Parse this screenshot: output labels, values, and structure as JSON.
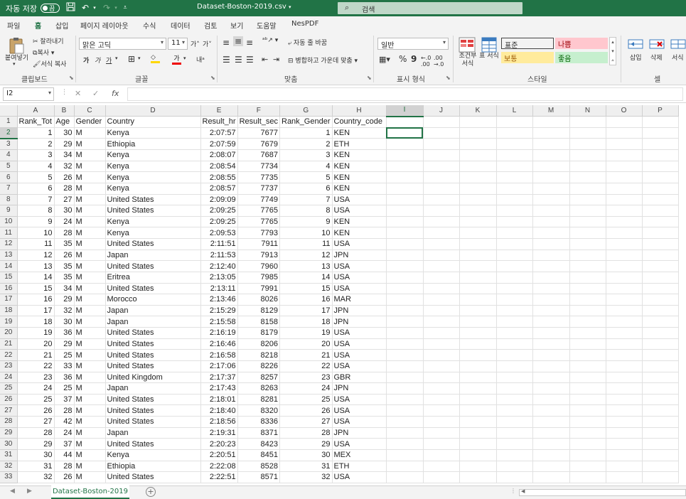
{
  "titlebar": {
    "autosave_label": "자동 저장",
    "autosave_state": "끔",
    "filename": "Dataset-Boston-2019.csv",
    "search_placeholder": "검색"
  },
  "ribbon_tabs": [
    "파일",
    "홈",
    "삽입",
    "페이지 레이아웃",
    "수식",
    "데이터",
    "검토",
    "보기",
    "도움말",
    "NesPDF"
  ],
  "active_tab": "홈",
  "ribbon": {
    "clipboard": {
      "paste": "붙여넣기",
      "cut": "잘라내기",
      "copy": "복사",
      "format_painter": "서식 복사",
      "group": "클립보드"
    },
    "font": {
      "name": "맑은 고딕",
      "size": "11",
      "bold": "가",
      "italic": "가",
      "underline": "가",
      "group": "글꼴"
    },
    "alignment": {
      "wrap": "자동 줄 바꿈",
      "merge": "병합하고 가운데 맞춤",
      "group": "맞춤"
    },
    "number": {
      "format": "일반",
      "group": "표시 형식"
    },
    "styles": {
      "conditional": "조건부 서식",
      "table": "표 서식",
      "cells": [
        {
          "label": "표준",
          "bg": "#ffffff",
          "fg": "#000000"
        },
        {
          "label": "나쁨",
          "bg": "#ffc7ce",
          "fg": "#9c0006"
        },
        {
          "label": "보통",
          "bg": "#ffeb9c",
          "fg": "#9c5700"
        },
        {
          "label": "좋음",
          "bg": "#c6efce",
          "fg": "#006100"
        }
      ],
      "group": "스타일"
    },
    "cells": {
      "insert": "삽입",
      "delete": "삭제",
      "format": "서식",
      "group": "셀"
    }
  },
  "formula_bar": {
    "name_box": "I2",
    "formula": ""
  },
  "columns": [
    "A",
    "B",
    "C",
    "D",
    "E",
    "F",
    "G",
    "H",
    "I",
    "J",
    "K",
    "L",
    "M",
    "N",
    "O",
    "P"
  ],
  "selected_column": "I",
  "selected_row": 2,
  "headers": [
    "Rank_Tot",
    "Age",
    "Gender",
    "Country",
    "Result_hr",
    "Result_sec",
    "Rank_Gender",
    "Country_code"
  ],
  "rows": [
    [
      "1",
      "30",
      "M",
      "Kenya",
      "2:07:57",
      "7677",
      "1",
      "KEN"
    ],
    [
      "2",
      "29",
      "M",
      "Ethiopia",
      "2:07:59",
      "7679",
      "2",
      "ETH"
    ],
    [
      "3",
      "34",
      "M",
      "Kenya",
      "2:08:07",
      "7687",
      "3",
      "KEN"
    ],
    [
      "4",
      "32",
      "M",
      "Kenya",
      "2:08:54",
      "7734",
      "4",
      "KEN"
    ],
    [
      "5",
      "26",
      "M",
      "Kenya",
      "2:08:55",
      "7735",
      "5",
      "KEN"
    ],
    [
      "6",
      "28",
      "M",
      "Kenya",
      "2:08:57",
      "7737",
      "6",
      "KEN"
    ],
    [
      "7",
      "27",
      "M",
      "United States",
      "2:09:09",
      "7749",
      "7",
      "USA"
    ],
    [
      "8",
      "30",
      "M",
      "United States",
      "2:09:25",
      "7765",
      "8",
      "USA"
    ],
    [
      "9",
      "24",
      "M",
      "Kenya",
      "2:09:25",
      "7765",
      "9",
      "KEN"
    ],
    [
      "10",
      "28",
      "M",
      "Kenya",
      "2:09:53",
      "7793",
      "10",
      "KEN"
    ],
    [
      "11",
      "35",
      "M",
      "United States",
      "2:11:51",
      "7911",
      "11",
      "USA"
    ],
    [
      "12",
      "26",
      "M",
      "Japan",
      "2:11:53",
      "7913",
      "12",
      "JPN"
    ],
    [
      "13",
      "35",
      "M",
      "United States",
      "2:12:40",
      "7960",
      "13",
      "USA"
    ],
    [
      "14",
      "35",
      "M",
      "Eritrea",
      "2:13:05",
      "7985",
      "14",
      "USA"
    ],
    [
      "15",
      "34",
      "M",
      "United States",
      "2:13:11",
      "7991",
      "15",
      "USA"
    ],
    [
      "16",
      "29",
      "M",
      "Morocco",
      "2:13:46",
      "8026",
      "16",
      "MAR"
    ],
    [
      "17",
      "32",
      "M",
      "Japan",
      "2:15:29",
      "8129",
      "17",
      "JPN"
    ],
    [
      "18",
      "30",
      "M",
      "Japan",
      "2:15:58",
      "8158",
      "18",
      "JPN"
    ],
    [
      "19",
      "36",
      "M",
      "United States",
      "2:16:19",
      "8179",
      "19",
      "USA"
    ],
    [
      "20",
      "29",
      "M",
      "United States",
      "2:16:46",
      "8206",
      "20",
      "USA"
    ],
    [
      "21",
      "25",
      "M",
      "United States",
      "2:16:58",
      "8218",
      "21",
      "USA"
    ],
    [
      "22",
      "33",
      "M",
      "United States",
      "2:17:06",
      "8226",
      "22",
      "USA"
    ],
    [
      "23",
      "36",
      "M",
      "United Kingdom",
      "2:17:37",
      "8257",
      "23",
      "GBR"
    ],
    [
      "24",
      "25",
      "M",
      "Japan",
      "2:17:43",
      "8263",
      "24",
      "JPN"
    ],
    [
      "25",
      "37",
      "M",
      "United States",
      "2:18:01",
      "8281",
      "25",
      "USA"
    ],
    [
      "26",
      "28",
      "M",
      "United States",
      "2:18:40",
      "8320",
      "26",
      "USA"
    ],
    [
      "27",
      "42",
      "M",
      "United States",
      "2:18:56",
      "8336",
      "27",
      "USA"
    ],
    [
      "28",
      "24",
      "M",
      "Japan",
      "2:19:31",
      "8371",
      "28",
      "JPN"
    ],
    [
      "29",
      "37",
      "M",
      "United States",
      "2:20:23",
      "8423",
      "29",
      "USA"
    ],
    [
      "30",
      "44",
      "M",
      "Kenya",
      "2:20:51",
      "8451",
      "30",
      "MEX"
    ],
    [
      "31",
      "28",
      "M",
      "Ethiopia",
      "2:22:08",
      "8528",
      "31",
      "ETH"
    ],
    [
      "32",
      "26",
      "M",
      "United States",
      "2:22:51",
      "8571",
      "32",
      "USA"
    ]
  ],
  "sheet_tab": "Dataset-Boston-2019",
  "colors": {
    "accent": "#217346"
  }
}
